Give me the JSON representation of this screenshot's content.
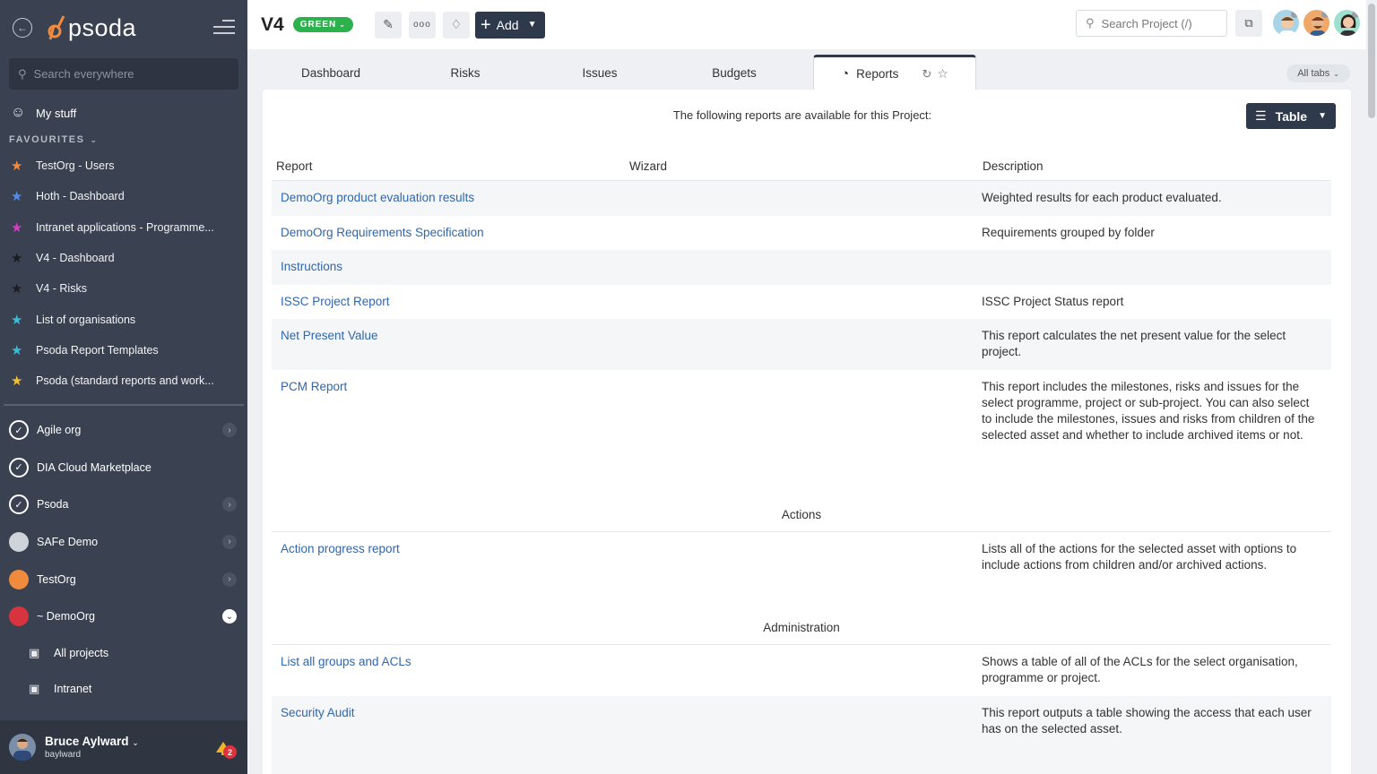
{
  "sidebar": {
    "logo_text": "psoda",
    "search_placeholder": "Search everywhere",
    "my_stuff": "My stuff",
    "favourites_header": "FAVOURITES",
    "favourites": [
      {
        "label": "TestOrg - Users",
        "color": "#f08a3c"
      },
      {
        "label": "Hoth - Dashboard",
        "color": "#4f8ee8"
      },
      {
        "label": "Intranet applications - Programme...",
        "color": "#d13ec0"
      },
      {
        "label": "V4 - Dashboard",
        "color": "#1a1d22"
      },
      {
        "label": "V4 - Risks",
        "color": "#1a1d22"
      },
      {
        "label": "List of organisations",
        "color": "#3fb9d9"
      },
      {
        "label": "Psoda Report Templates",
        "color": "#3fb9d9"
      },
      {
        "label": "Psoda (standard reports and work...",
        "color": "#f4c033"
      }
    ],
    "orgs": [
      {
        "label": "Agile org",
        "has_chevron": true
      },
      {
        "label": "DIA Cloud Marketplace",
        "has_chevron": false
      },
      {
        "label": "Psoda",
        "has_chevron": true
      },
      {
        "label": "SAFe Demo",
        "has_chevron": true
      },
      {
        "label": "TestOrg",
        "has_chevron": true
      },
      {
        "label": "~ DemoOrg",
        "has_chevron": true
      }
    ],
    "sub_items": [
      "All projects",
      "Intranet"
    ],
    "user": {
      "name": "Bruce Aylward",
      "handle": "baylward",
      "notifications": "2"
    }
  },
  "topbar": {
    "title": "V4",
    "status": "GREEN",
    "add_label": "Add",
    "search_placeholder": "Search Project (/)"
  },
  "tabs": {
    "items": [
      "Dashboard",
      "Risks",
      "Issues",
      "Budgets",
      "Reports"
    ],
    "active": "Reports",
    "all_tabs": "All tabs"
  },
  "content": {
    "intro": "The following reports are available for this Project:",
    "view_label": "Table",
    "columns": [
      "Report",
      "Wizard",
      "Description"
    ],
    "rows": [
      {
        "report": "DemoOrg product evaluation results",
        "description": "Weighted results for each product evaluated."
      },
      {
        "report": "DemoOrg Requirements Specification",
        "description": "Requirements grouped by folder"
      },
      {
        "report": "Instructions",
        "description": ""
      },
      {
        "report": "ISSC Project Report",
        "description": "ISSC Project Status report"
      },
      {
        "report": "Net Present Value",
        "description": "This report calculates the net present value for the select project."
      },
      {
        "report": "PCM Report",
        "description": "This report includes the milestones, risks and issues for the select programme, project or sub-project. You can also select to include the milestones, issues and risks from children of the selected asset and whether to include archived items or not."
      }
    ],
    "groups": [
      {
        "name": "Actions",
        "rows": [
          {
            "report": "Action progress report",
            "description": "Lists all of the actions for the selected asset with options to include actions from children and/or archived actions."
          }
        ]
      },
      {
        "name": "Administration",
        "rows": [
          {
            "report": "List all groups and ACLs",
            "description": "Shows a table of all of the ACLs for the select organisation, programme or project."
          },
          {
            "report": "Security Audit",
            "description": "This report outputs a table showing the access that each user has on the selected asset."
          }
        ]
      }
    ]
  }
}
